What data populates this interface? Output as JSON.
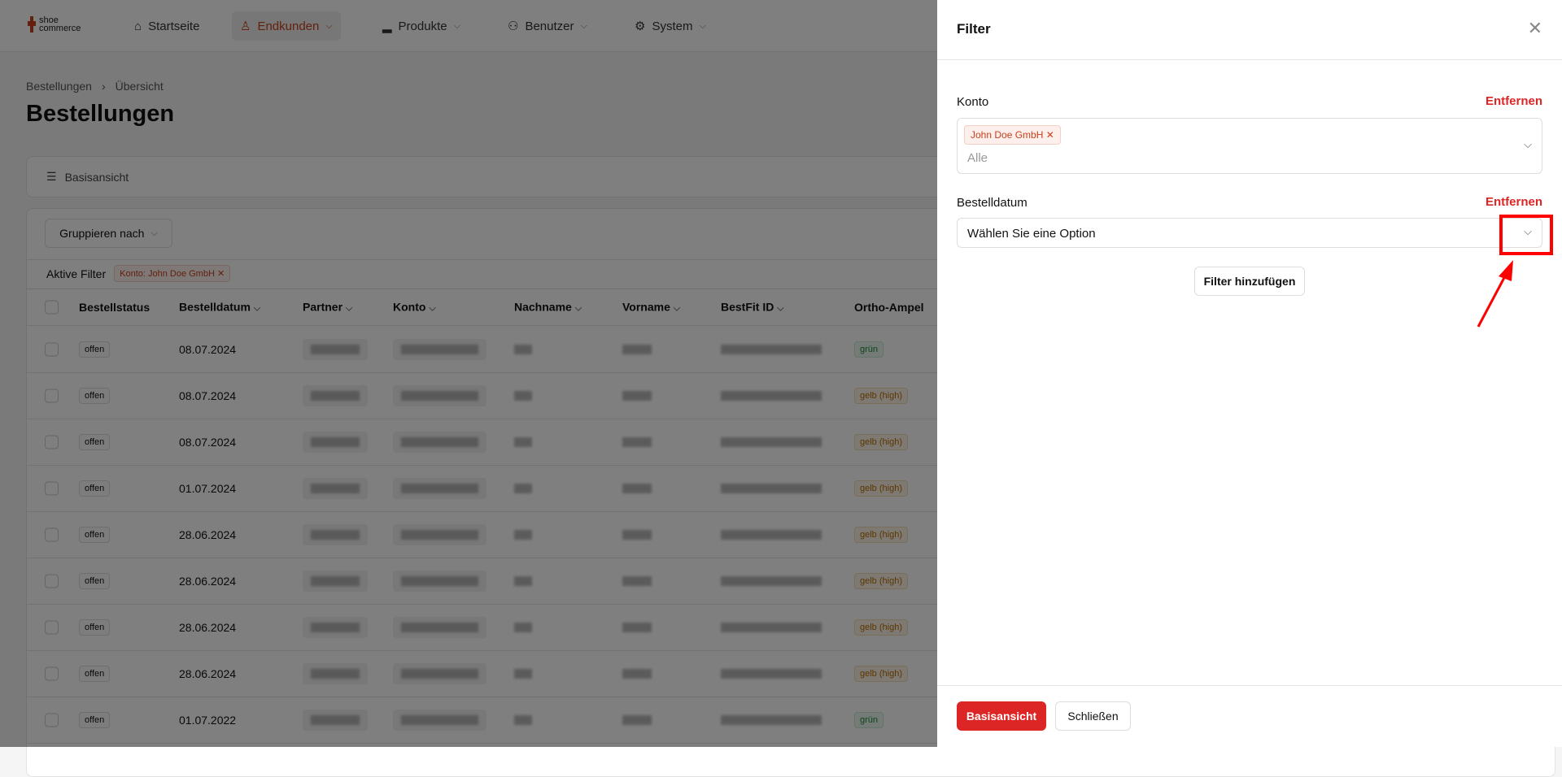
{
  "nav": {
    "logo_line1": "shoe",
    "logo_line2": "commerce",
    "items": [
      {
        "label": "Startseite",
        "icon": "home-icon"
      },
      {
        "label": "Endkunden",
        "icon": "user-icon"
      },
      {
        "label": "Produkte",
        "icon": "shoe-icon"
      },
      {
        "label": "Benutzer",
        "icon": "users-icon"
      },
      {
        "label": "System",
        "icon": "gear-icon"
      }
    ]
  },
  "breadcrumb": [
    "Bestellungen",
    "Übersicht"
  ],
  "page_title": "Bestellungen",
  "view": {
    "label": "Basisansicht"
  },
  "toolbar": {
    "group_by": "Gruppieren nach",
    "active_filters_label": "Aktive Filter",
    "active_filter": "Konto: John Doe GmbH"
  },
  "table": {
    "columns": [
      "Bestellstatus",
      "Bestelldatum",
      "Partner",
      "Konto",
      "Nachname",
      "Vorname",
      "BestFit ID",
      "Ortho-Ampel"
    ],
    "rows": [
      {
        "status": "offen",
        "date": "08.07.2024",
        "ampel": "grün"
      },
      {
        "status": "offen",
        "date": "08.07.2024",
        "ampel": "gelb (high)"
      },
      {
        "status": "offen",
        "date": "08.07.2024",
        "ampel": "gelb (high)"
      },
      {
        "status": "offen",
        "date": "01.07.2024",
        "ampel": "gelb (high)"
      },
      {
        "status": "offen",
        "date": "28.06.2024",
        "ampel": "gelb (high)"
      },
      {
        "status": "offen",
        "date": "28.06.2024",
        "ampel": "gelb (high)"
      },
      {
        "status": "offen",
        "date": "28.06.2024",
        "ampel": "gelb (high)"
      },
      {
        "status": "offen",
        "date": "28.06.2024",
        "ampel": "gelb (high)"
      },
      {
        "status": "offen",
        "date": "01.07.2022",
        "ampel": "grün"
      }
    ]
  },
  "filter_panel": {
    "title": "Filter",
    "konto_label": "Konto",
    "remove": "Entfernen",
    "konto_tag": "John Doe GmbH",
    "konto_placeholder": "Alle",
    "date_label": "Bestelldatum",
    "date_placeholder": "Wählen Sie eine Option",
    "add_filter": "Filter hinzufügen",
    "primary": "Basisansicht",
    "close": "Schließen"
  },
  "colors": {
    "accent": "#c8401c",
    "danger": "#dc2626"
  }
}
